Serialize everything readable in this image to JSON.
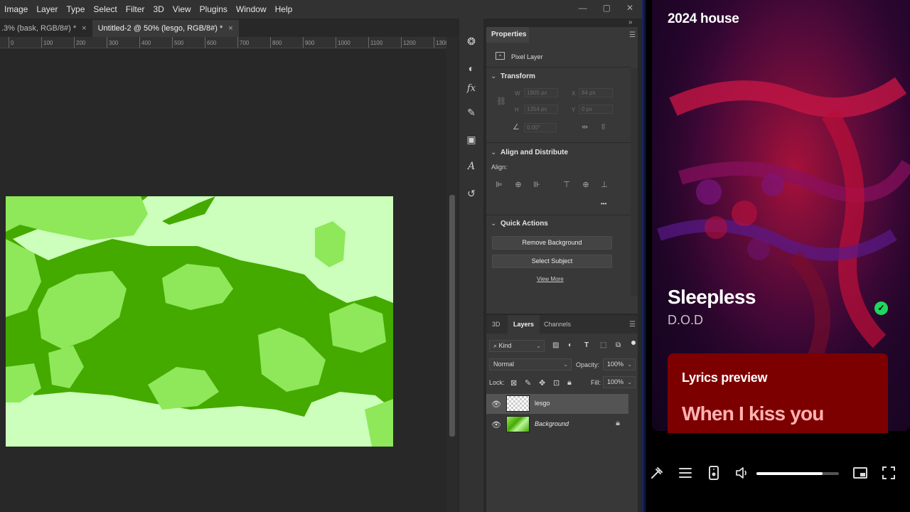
{
  "photoshop": {
    "menu": [
      "Image",
      "Layer",
      "Type",
      "Select",
      "Filter",
      "3D",
      "View",
      "Plugins",
      "Window",
      "Help"
    ],
    "window_controls": [
      "—",
      "▢",
      "✕"
    ],
    "tabs": [
      {
        "label": ".3% (bask, RGB/8#) *",
        "close": "×"
      },
      {
        "label": "Untitled-2 @ 50% (lesgo, RGB/8#) *",
        "close": "×"
      }
    ],
    "ruler_ticks": [
      "0",
      "100",
      "200",
      "300",
      "400",
      "500",
      "600",
      "700",
      "800",
      "900",
      "1000",
      "1100",
      "1200",
      "1300"
    ],
    "properties": {
      "title": "Properties",
      "layer_type": "Pixel Layer",
      "transform": {
        "heading": "Transform",
        "w_label": "W",
        "w_value": "1905 px",
        "h_label": "H",
        "h_value": "1354 px",
        "x_label": "X",
        "x_value": "84 px",
        "y_label": "Y",
        "y_value": "0 px",
        "angle_value": "0.00°"
      },
      "align": {
        "heading": "Align and Distribute",
        "label": "Align:",
        "more": "•••"
      },
      "quick_actions": {
        "heading": "Quick Actions",
        "remove_background": "Remove Background",
        "select_subject": "Select Subject",
        "view_more": "View More"
      }
    },
    "layers_panel": {
      "tabs": [
        "3D",
        "Layers",
        "Channels"
      ],
      "active_tab": "Layers",
      "filter_kind": "Kind",
      "blend_mode": "Normal",
      "opacity_label": "Opacity:",
      "opacity_value": "100%",
      "lock_label": "Lock:",
      "fill_label": "Fill:",
      "fill_value": "100%",
      "layers": [
        {
          "name": "lesgo",
          "selected": true,
          "locked": false
        },
        {
          "name": "Background",
          "selected": false,
          "locked": true
        }
      ]
    },
    "artwork_colors": {
      "dark_green": "#44aa00",
      "mid_green": "#8ee85a",
      "light_green": "#ccffbb"
    }
  },
  "player": {
    "playlist": "2024 house",
    "song_title": "Sleepless",
    "artist": "D.O.D",
    "liked": true,
    "lyrics_heading": "Lyrics preview",
    "lyrics_line": "When I kiss you",
    "volume": 0.8,
    "accent": "#1ed760",
    "lyrics_bg": "#7d0000"
  }
}
